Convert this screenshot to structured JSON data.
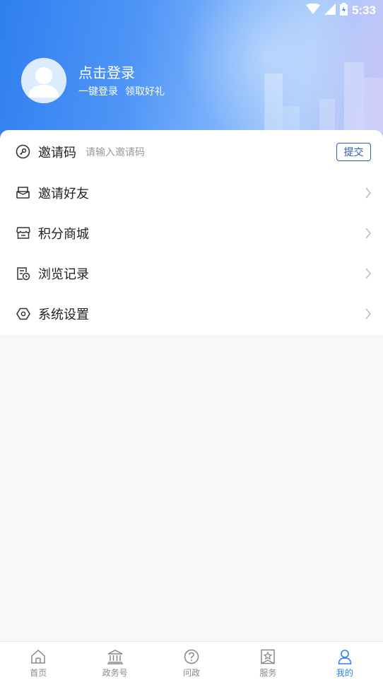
{
  "status_bar": {
    "time": "5:33"
  },
  "header": {
    "login_title": "点击登录",
    "login_sub_1": "一键登录",
    "login_sub_2": "领取好礼"
  },
  "invite": {
    "label": "邀请码",
    "placeholder": "请输入邀请码",
    "submit_label": "提交"
  },
  "menu": {
    "items": [
      {
        "label": "邀请好友",
        "icon": "envelope-icon"
      },
      {
        "label": "积分商城",
        "icon": "shop-icon"
      },
      {
        "label": "浏览记录",
        "icon": "history-icon"
      },
      {
        "label": "系统设置",
        "icon": "settings-icon"
      }
    ]
  },
  "tabbar": {
    "items": [
      {
        "label": "首页",
        "icon": "home-icon",
        "active": false
      },
      {
        "label": "政务号",
        "icon": "government-icon",
        "active": false
      },
      {
        "label": "问政",
        "icon": "question-icon",
        "active": false
      },
      {
        "label": "服务",
        "icon": "service-icon",
        "active": false
      },
      {
        "label": "我的",
        "icon": "user-icon",
        "active": true
      }
    ]
  },
  "colors": {
    "accent": "#2f7ff0",
    "submit_border": "#2e5fb0",
    "tab_inactive": "#888888"
  }
}
